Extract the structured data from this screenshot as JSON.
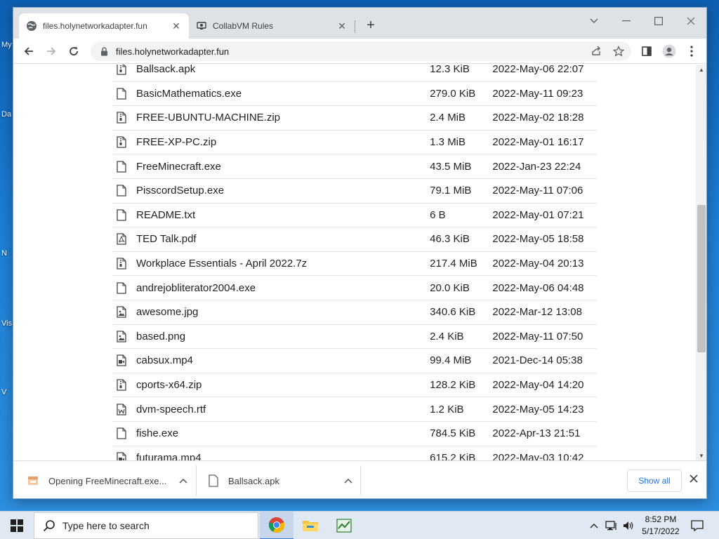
{
  "desktop": {
    "fragments": [
      "My",
      "Da",
      "N",
      "Vis",
      "V"
    ]
  },
  "browser": {
    "tabs": [
      {
        "title": "files.holynetworkadapter.fun",
        "icon": "globe-icon",
        "active": true
      },
      {
        "title": "CollabVM Rules",
        "icon": "collabvm-icon",
        "active": false
      }
    ],
    "url": "files.holynetworkadapter.fun"
  },
  "files": [
    {
      "name": "Ballsack.apk",
      "size": "12.3 KiB",
      "date": "2022-May-06 22:07",
      "icon": "archive-file-icon"
    },
    {
      "name": "BasicMathematics.exe",
      "size": "279.0 KiB",
      "date": "2022-May-11 09:23",
      "icon": "file-icon"
    },
    {
      "name": "FREE-UBUNTU-MACHINE.zip",
      "size": "2.4 MiB",
      "date": "2022-May-02 18:28",
      "icon": "archive-file-icon"
    },
    {
      "name": "FREE-XP-PC.zip",
      "size": "1.3 MiB",
      "date": "2022-May-01 16:17",
      "icon": "archive-file-icon"
    },
    {
      "name": "FreeMinecraft.exe",
      "size": "43.5 MiB",
      "date": "2022-Jan-23 22:24",
      "icon": "file-icon"
    },
    {
      "name": "PisscordSetup.exe",
      "size": "79.1 MiB",
      "date": "2022-May-11 07:06",
      "icon": "file-icon"
    },
    {
      "name": "README.txt",
      "size": "6 B",
      "date": "2022-May-01 07:21",
      "icon": "file-icon"
    },
    {
      "name": "TED Talk.pdf",
      "size": "46.3 KiB",
      "date": "2022-May-05 18:58",
      "icon": "pdf-file-icon"
    },
    {
      "name": "Workplace Essentials - April 2022.7z",
      "size": "217.4 MiB",
      "date": "2022-May-04 20:13",
      "icon": "archive-file-icon"
    },
    {
      "name": "andrejobliterator2004.exe",
      "size": "20.0 KiB",
      "date": "2022-May-06 04:48",
      "icon": "file-icon"
    },
    {
      "name": "awesome.jpg",
      "size": "340.6 KiB",
      "date": "2022-Mar-12 13:08",
      "icon": "image-file-icon"
    },
    {
      "name": "based.png",
      "size": "2.4 KiB",
      "date": "2022-May-11 07:50",
      "icon": "image-file-icon"
    },
    {
      "name": "cabsux.mp4",
      "size": "99.4 MiB",
      "date": "2021-Dec-14 05:38",
      "icon": "video-file-icon"
    },
    {
      "name": "cports-x64.zip",
      "size": "128.2 KiB",
      "date": "2022-May-04 14:20",
      "icon": "archive-file-icon"
    },
    {
      "name": "dvm-speech.rtf",
      "size": "1.2 KiB",
      "date": "2022-May-05 14:23",
      "icon": "word-file-icon"
    },
    {
      "name": "fishe.exe",
      "size": "784.5 KiB",
      "date": "2022-Apr-13 21:51",
      "icon": "file-icon"
    },
    {
      "name": "futurama.mp4",
      "size": "615.2 KiB",
      "date": "2022-May-03 10:42",
      "icon": "video-file-icon"
    }
  ],
  "downloads": [
    {
      "label": "Opening FreeMinecraft.exe...",
      "icon": "installer-icon"
    },
    {
      "label": "Ballsack.apk",
      "icon": "file-icon"
    }
  ],
  "download_bar": {
    "show_all": "Show all"
  },
  "taskbar": {
    "search_placeholder": "Type here to search",
    "time": "8:52 PM",
    "date": "5/17/2022"
  },
  "colors": {
    "accent": "#1a73e8",
    "desktop": "#1c7fd6"
  }
}
